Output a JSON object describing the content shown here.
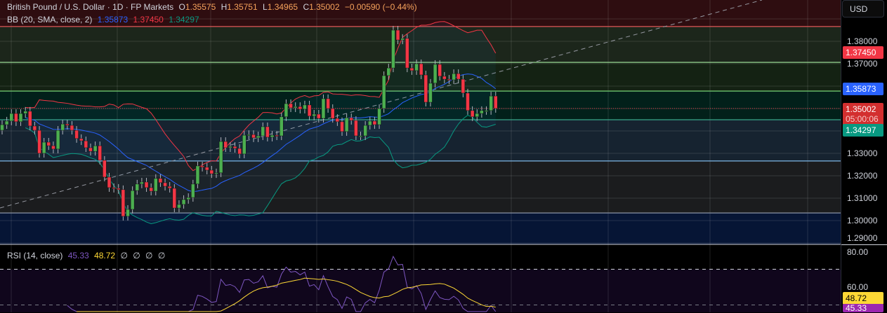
{
  "header": {
    "symbol": "British Pound / U.S. Dollar · 1D · FP Markets",
    "o_label": "O",
    "o": "1.35575",
    "h_label": "H",
    "h": "1.35751",
    "l_label": "L",
    "l": "1.34965",
    "c_label": "C",
    "c": "1.35002",
    "change": "−0.00590 (−0.44%)"
  },
  "bb_legend": {
    "label": "BB (20, SMA, close, 2)",
    "basis": "1.35873",
    "upper": "1.37450",
    "lower": "1.34297"
  },
  "rsi_legend": {
    "label": "RSI (14, close)",
    "rsi": "45.33",
    "ma": "48.72",
    "extras": [
      "∅",
      "∅",
      "∅",
      "∅"
    ]
  },
  "axis": {
    "currency_button": "USD",
    "price_ticks": [
      "1.38000",
      "1.37000",
      "1.33000",
      "1.32000",
      "1.31000",
      "1.30000",
      "1.29000"
    ],
    "rsi_ticks": [
      "80.00",
      "60.00"
    ],
    "tags": {
      "upper": "1.37450",
      "basis": "1.35873",
      "last": "1.35002",
      "countdown": "05:00:06",
      "lower": "1.34297",
      "rsi_ma": "48.72",
      "rsi": "45.33"
    }
  },
  "colors": {
    "up": "#4caf50",
    "down": "#f23645",
    "basis": "#2962ff",
    "upper": "#f23645",
    "lower": "#089981",
    "rsi": "#7e57c2",
    "rsi_ma": "#fdd835"
  },
  "chart_data": {
    "type": "candlestick",
    "title": "British Pound / U.S. Dollar · 1D",
    "ylim": [
      1.29,
      1.39
    ],
    "first_open": 1.3403,
    "closes": [
      1.3428,
      1.3444,
      1.3478,
      1.3441,
      1.3478,
      1.3488,
      1.3422,
      1.3403,
      1.33,
      1.335,
      1.3334,
      1.3319,
      1.3403,
      1.3431,
      1.3425,
      1.3403,
      1.3366,
      1.3356,
      1.3325,
      1.3309,
      1.3334,
      1.3269,
      1.3194,
      1.3147,
      1.3144,
      1.3138,
      1.3019,
      1.305,
      1.3134,
      1.3163,
      1.3172,
      1.3147,
      1.3131,
      1.3188,
      1.3169,
      1.3153,
      1.3144,
      1.3056,
      1.3072,
      1.3094,
      1.3103,
      1.3163,
      1.3244,
      1.3238,
      1.3225,
      1.3209,
      1.3213,
      1.3353,
      1.3325,
      1.3331,
      1.3322,
      1.3297,
      1.3381,
      1.3384,
      1.3369,
      1.3378,
      1.3419,
      1.3372,
      1.3381,
      1.3378,
      1.3463,
      1.3522,
      1.3503,
      1.3509,
      1.3497,
      1.3516,
      1.3466,
      1.3475,
      1.3456,
      1.3544,
      1.35,
      1.3456,
      1.3441,
      1.3397,
      1.3459,
      1.3447,
      1.3378,
      1.3378,
      1.3425,
      1.3444,
      1.3428,
      1.35,
      1.3647,
      1.3681,
      1.385,
      1.3806,
      1.3813,
      1.3681,
      1.3669,
      1.37,
      1.365,
      1.3528,
      1.3613,
      1.3697,
      1.3644,
      1.3631,
      1.3628,
      1.3656,
      1.3631,
      1.3569,
      1.3491,
      1.3463,
      1.3478,
      1.3491,
      1.3491,
      1.3556,
      1.35002
    ],
    "horizontal_levels": [
      1.3866,
      1.3706,
      1.3578,
      1.345,
      1.3266,
      1.3034
    ],
    "indicators": [
      "Bollinger Bands (20, 2)",
      "RSI (14)"
    ],
    "rsi_ylim": [
      45,
      84
    ],
    "rsi_levels": [
      70,
      50
    ]
  }
}
